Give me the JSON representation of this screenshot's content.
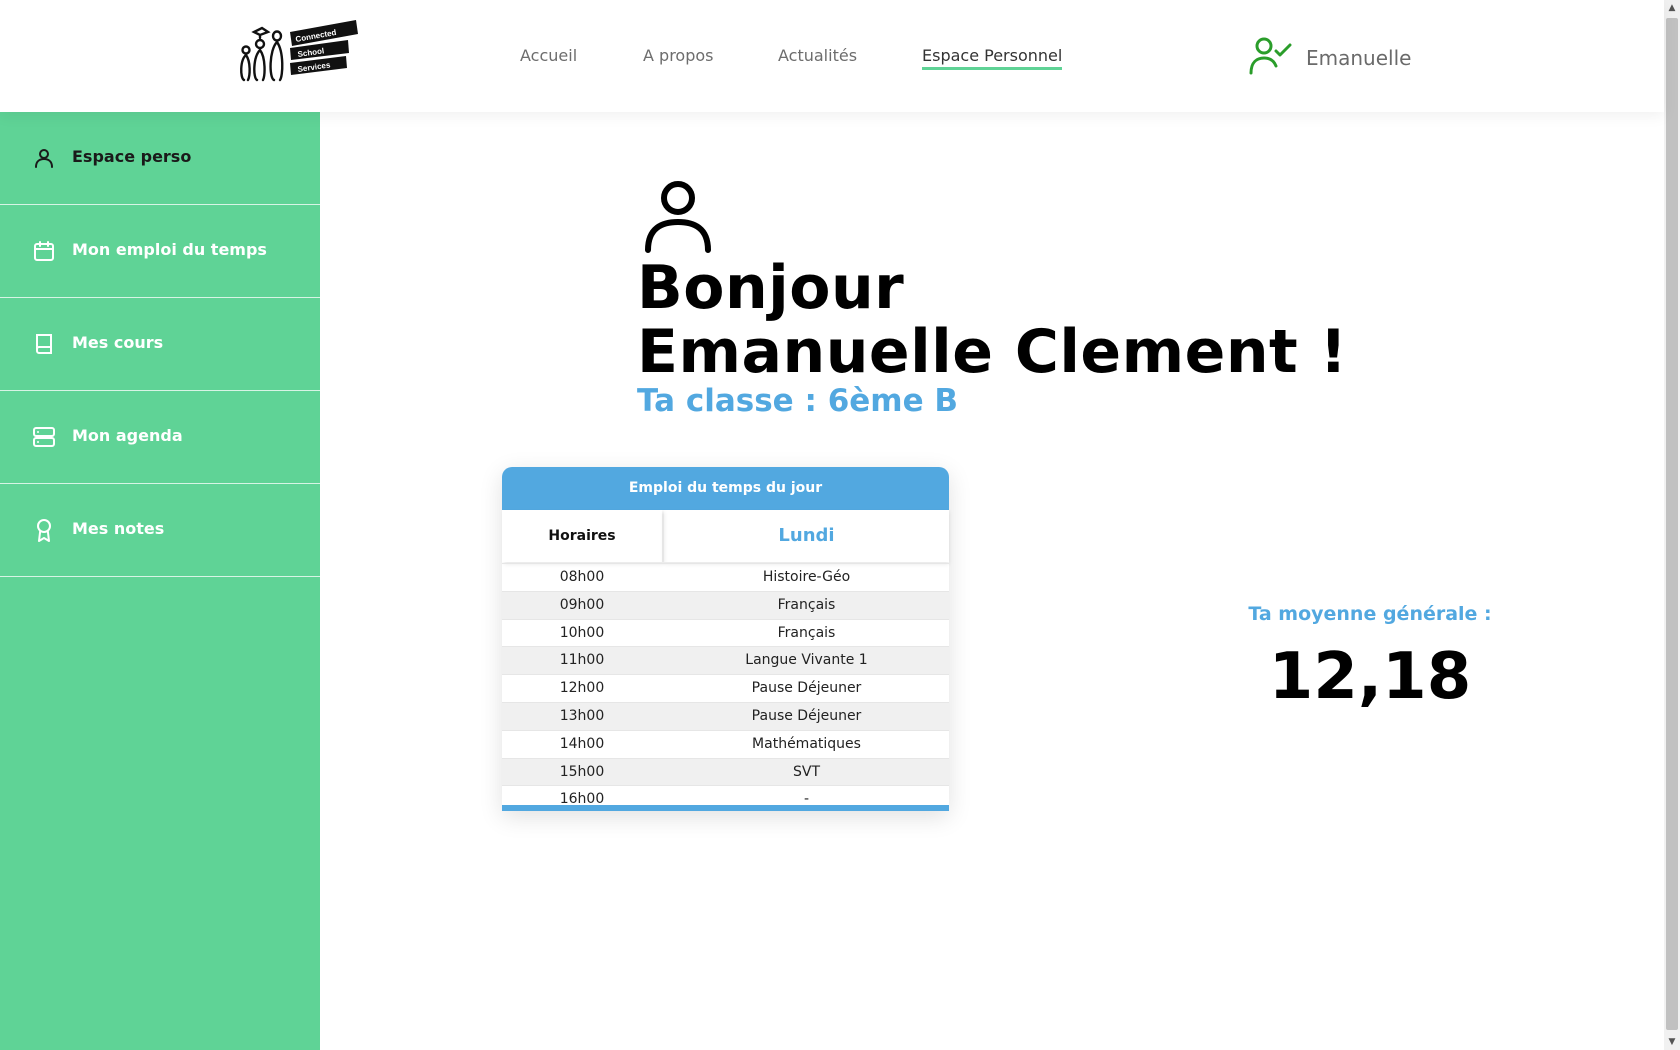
{
  "header": {
    "logo_lines": [
      "Connected",
      "School",
      "Services"
    ],
    "nav": [
      {
        "label": "Accueil"
      },
      {
        "label": "A propos"
      },
      {
        "label": "Actualités"
      },
      {
        "label": "Espace Personnel",
        "active": true
      }
    ],
    "user": {
      "name": "Emanuelle",
      "icon": "user-check-icon"
    }
  },
  "sidebar": {
    "items": [
      {
        "label": "Espace perso",
        "icon": "user-icon",
        "active": true
      },
      {
        "label": "Mon emploi du temps",
        "icon": "calendar-icon"
      },
      {
        "label": "Mes cours",
        "icon": "book-icon"
      },
      {
        "label": "Mon agenda",
        "icon": "server-icon"
      },
      {
        "label": "Mes notes",
        "icon": "award-icon"
      }
    ]
  },
  "main": {
    "greeting_line1": "Bonjour",
    "greeting_line2": "Emanuelle Clement !",
    "classe": "Ta classe : 6ème B",
    "timetable": {
      "title": "Emploi du temps du jour",
      "col_time": "Horaires",
      "col_day": "Lundi",
      "rows": [
        {
          "time": "08h00",
          "subject": "Histoire-Géo"
        },
        {
          "time": "09h00",
          "subject": "Français"
        },
        {
          "time": "10h00",
          "subject": "Français"
        },
        {
          "time": "11h00",
          "subject": "Langue Vivante 1"
        },
        {
          "time": "12h00",
          "subject": "Pause Déjeuner"
        },
        {
          "time": "13h00",
          "subject": "Pause Déjeuner"
        },
        {
          "time": "14h00",
          "subject": "Mathématiques"
        },
        {
          "time": "15h00",
          "subject": "SVT"
        },
        {
          "time": "16h00",
          "subject": "-"
        }
      ]
    },
    "average": {
      "label": "Ta moyenne générale :",
      "value": "12,18"
    }
  },
  "colors": {
    "green": "#5fd396",
    "blue": "#52a8e0",
    "user_icon": "#2a9d2a"
  }
}
